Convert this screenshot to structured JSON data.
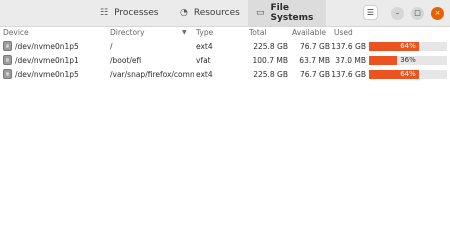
{
  "tabs": [
    {
      "label": "Processes",
      "icon": "list-icon",
      "active": false
    },
    {
      "label": "Resources",
      "icon": "gauge-icon",
      "active": false
    },
    {
      "label": "File Systems",
      "icon": "drive-icon",
      "active": true
    }
  ],
  "window_controls": {
    "menu": "☰",
    "minimize": "–",
    "maximize": "□",
    "close": "×"
  },
  "columns": {
    "device": "Device",
    "directory": "Directory",
    "type": "Type",
    "total": "Total",
    "available": "Available",
    "used": "Used"
  },
  "rows": [
    {
      "device": "/dev/nvme0n1p5",
      "directory": "/",
      "type": "ext4",
      "total": "225.8 GB",
      "available": "76.7 GB",
      "used": "137.6 GB",
      "percent_label": "64%",
      "percent": 64
    },
    {
      "device": "/dev/nvme0n1p1",
      "directory": "/boot/efi",
      "type": "vfat",
      "total": "100.7 MB",
      "available": "63.7 MB",
      "used": "37.0 MB",
      "percent_label": "36%",
      "percent": 36
    },
    {
      "device": "/dev/nvme0n1p5",
      "directory": "/var/snap/firefox/comn",
      "type": "ext4",
      "total": "225.8 GB",
      "available": "76.7 GB",
      "used": "137.6 GB",
      "percent_label": "64%",
      "percent": 64
    }
  ],
  "colors": {
    "accent": "#e95420",
    "close": "#e66100"
  }
}
